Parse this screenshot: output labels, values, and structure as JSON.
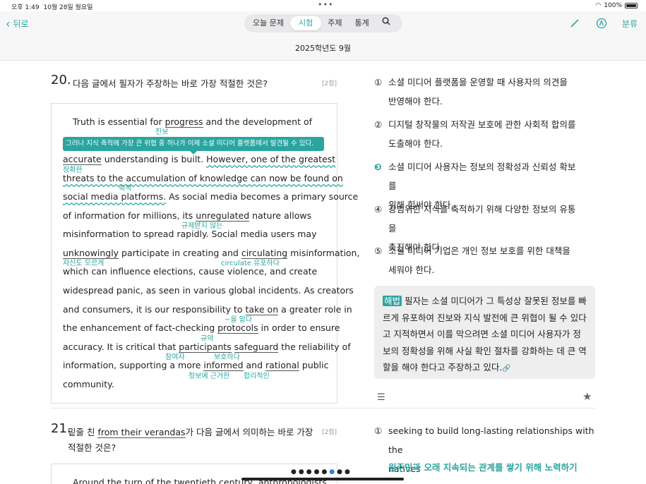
{
  "status": {
    "time": "오후 1:49",
    "date": "10월 28일 월요일",
    "battery": "100%"
  },
  "nav": {
    "back_label": "뒤로",
    "tabs": [
      {
        "label": "오늘 문제",
        "active": false
      },
      {
        "label": "시험",
        "active": true
      },
      {
        "label": "주제",
        "active": false
      },
      {
        "label": "통계",
        "active": false
      }
    ],
    "right_label": "분류",
    "subtitle": "2025학년도 9월"
  },
  "q20": {
    "number": "20.",
    "title": "다음 글에서 필자가 주장하는 바로 가장 적절한 것은?",
    "points": "[2점]",
    "tooltip": "그러나 지식 축적에 가장 큰 위협 중 하나가 이제 소셜 미디어 플랫폼에서 발견될 수 있다.",
    "lines": {
      "l1a": "Truth is essential for ",
      "l1b": "progress",
      "l1c": " and the development of",
      "l3a": "accurate",
      "l3b": " understanding is built. ",
      "l3c": "However, one of the greatest",
      "l4": "threats to the accumulation of knowledge can now be found on",
      "l5a": "social media platforms.",
      "l5b": " As social media becomes a primary source",
      "l6a": "of information for millions, its ",
      "l6b": "unregulated",
      "l6c": " nature allows",
      "l7": "misinformation to spread rapidly. Social media users may",
      "l8a": "unknowingly",
      "l8b": " participate in creating and ",
      "l8c": "circulating",
      "l8d": " misinformation,",
      "l9": "which can influence elections, cause violence, and create",
      "l10": "widespread panic, as seen in various global incidents. As creators",
      "l11a": "and consumers, it is our responsibility to ",
      "l11b": "take on",
      "l11c": " a greater role in",
      "l12a": "the enhancement of fact-checking ",
      "l12b": "protocols",
      "l12c": " in order to ensure",
      "l13a": "accuracy. It is critical that ",
      "l13b": "participants",
      "l13c": " ",
      "l13d": "safeguard",
      "l13e": " the reliability of",
      "l14a": "information, supporting a more ",
      "l14b": "informed",
      "l14c": " and ",
      "l14d": "rational",
      "l14e": " public",
      "l15": "community."
    },
    "glosses": {
      "progress": "진보",
      "accurate": "정확한",
      "accumulation": "축적",
      "unregulated": "규제받지 않는",
      "unknowingly": "자신도 모르게",
      "circulating": "circulate 유포하다",
      "take_on": "~을 맡다",
      "protocols": "규약",
      "participants": "참여자",
      "safeguard": "보호하다",
      "informed": "정보에 근거한",
      "rational": "합리적인"
    },
    "options": [
      {
        "mark": "①",
        "line1": "소셜 미디어 플랫폼을 운영할 때 사용자의 의견을",
        "line2": "반영해야 한다.",
        "selected": false
      },
      {
        "mark": "②",
        "line1": "디지털 창작물의 저작권 보호에 관한 사회적 합의를",
        "line2": "도출해야 한다.",
        "selected": false
      },
      {
        "mark": "❸",
        "line1": "소셜 미디어 사용자는 정보의 정확성과 신뢰성 확보를",
        "line2": "위해 힘써야 한다.",
        "selected": true
      },
      {
        "mark": "④",
        "line1": "광범위한 지식을 축적하기 위해 다양한 정보의 유통을",
        "line2": "촉진해야 한다.",
        "selected": false
      },
      {
        "mark": "⑤",
        "line1": "소셜 미디어 기업은 개인 정보 보호를 위한 대책을",
        "line2": "세워야 한다.",
        "selected": false
      }
    ],
    "explanation": {
      "tag": "해법",
      "l1": " 필자는 소셜 미디어가 그 특성상 잘못된 정보를 빠",
      "l2": "르게 유포하여 진보와 지식 발전에 큰 위협이 될 수 있다",
      "l3": "고 지적하면서 이를 막으려면 소셜 미디어 사용자가 정",
      "l4": "보의 정확성을 위해 사실 확인 절차를 강화하는 데 큰 역",
      "l5": "할을 해야 한다고 주장하고 있다."
    }
  },
  "q21": {
    "number": "21.",
    "title_a": "밑줄 친 ",
    "title_b": "from their verandas",
    "title_c": "가 다음 글에서 의미하는 바로 가장",
    "title_line2": "적절한 것은?",
    "points": "[2점]",
    "passage_start": "Around the turn of the twentieth century, anthropologists",
    "option1_mark": "①",
    "option1_line1": "seeking to build long-lasting relationships with the",
    "option1_line2": "natives",
    "option1_translation": "원주민과 오래 지속되는 관계를 쌓기 위해 노력하기"
  },
  "pager": {
    "total": 8,
    "current": 6
  }
}
